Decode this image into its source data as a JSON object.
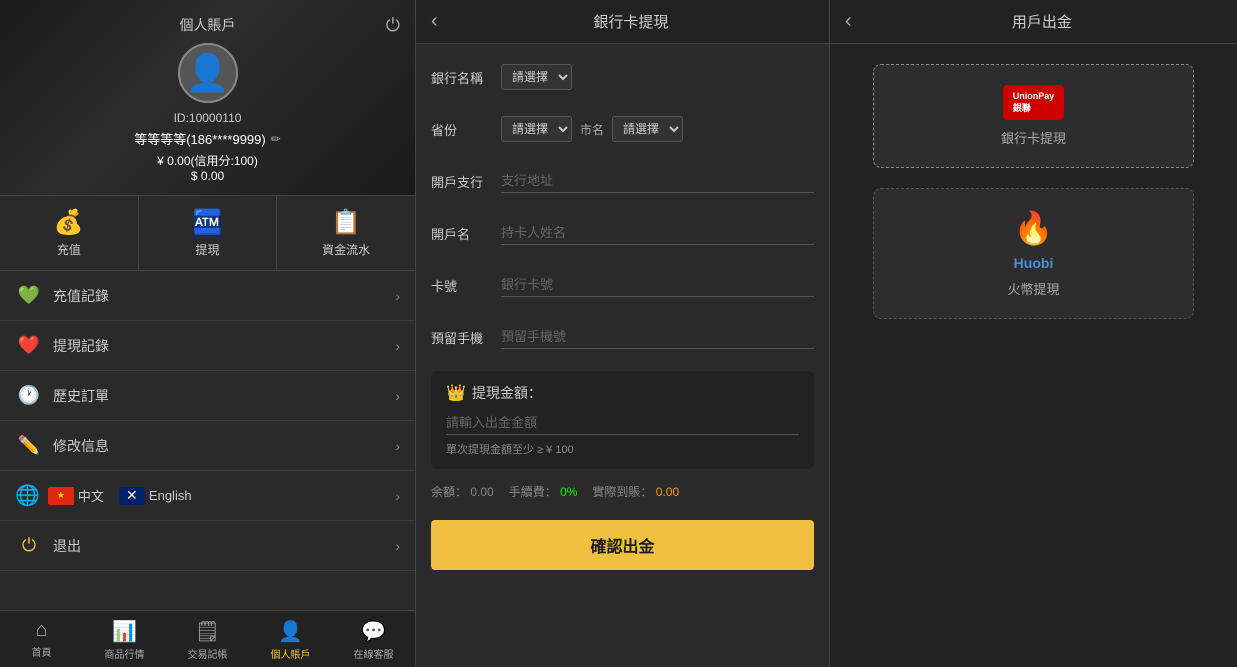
{
  "left": {
    "profile_title": "個人賬戶",
    "user_id": "ID:10000110",
    "user_name": "等等等等(186****9999)",
    "balance_cny": "¥ 0.00(信用分:100)",
    "balance_usd": "$ 0.00",
    "actions": [
      {
        "id": "deposit",
        "label": "充值",
        "icon": "💰"
      },
      {
        "id": "withdraw",
        "label": "提現",
        "icon": "🏧"
      },
      {
        "id": "flow",
        "label": "資金流水",
        "icon": "📋"
      }
    ],
    "menu_items": [
      {
        "id": "deposit-record",
        "label": "充值記錄",
        "icon": "💚"
      },
      {
        "id": "withdraw-record",
        "label": "提現記錄",
        "icon": "❤️"
      },
      {
        "id": "order-history",
        "label": "歷史訂單",
        "icon": "🕐"
      },
      {
        "id": "edit-info",
        "label": "修改信息",
        "icon": "✏️"
      }
    ],
    "language_items": [
      {
        "id": "zh",
        "label": "中文"
      },
      {
        "id": "en",
        "label": "English"
      }
    ],
    "logout_label": "退出",
    "nav_items": [
      {
        "id": "home",
        "label": "首頁",
        "icon": "⌂",
        "active": false
      },
      {
        "id": "market",
        "label": "商品行情",
        "icon": "📊",
        "active": false
      },
      {
        "id": "trades",
        "label": "交易記帳",
        "icon": "🗒",
        "active": false
      },
      {
        "id": "account",
        "label": "個人賬戶",
        "icon": "👤",
        "active": true
      },
      {
        "id": "service",
        "label": "在線客服",
        "icon": "💬",
        "active": false
      }
    ]
  },
  "middle": {
    "title": "銀行卡提現",
    "back_label": "‹",
    "form": {
      "bank_name_label": "銀行名稱",
      "bank_name_placeholder": "請選擇",
      "province_label": "省份",
      "province_placeholder": "請選擇",
      "city_label": "市名",
      "city_placeholder": "請選擇",
      "branch_label": "開戶支行",
      "branch_placeholder": "支行地址",
      "account_name_label": "開戶名",
      "account_name_placeholder": "持卡人姓名",
      "card_number_label": "卡號",
      "card_number_placeholder": "銀行卡號",
      "phone_label": "預留手機",
      "phone_placeholder": "預留手機號"
    },
    "amount_section": {
      "label": "提現金額：",
      "placeholder": "請輸入出金金額",
      "min_note": "單次提現金額至少 ≥ ¥ 100",
      "balance_label": "余額：",
      "balance_value": "0.00",
      "fee_label": "手續費：",
      "fee_value": "0%",
      "actual_label": "實際到賬：",
      "actual_value": "0.00"
    },
    "confirm_button": "確認出金"
  },
  "right": {
    "title": "用戶出金",
    "back_label": "‹",
    "options": [
      {
        "id": "bank-card",
        "label": "銀行卡提現",
        "type": "unionpay",
        "active": true
      },
      {
        "id": "huobi",
        "label": "火幣提現",
        "type": "huobi",
        "active": false
      }
    ]
  }
}
